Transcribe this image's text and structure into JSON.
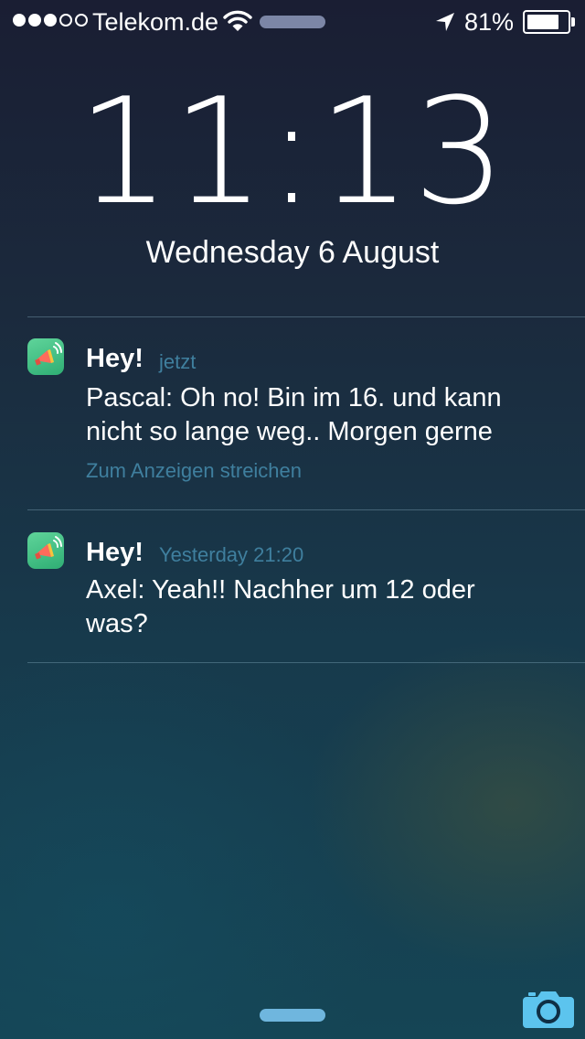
{
  "status_bar": {
    "carrier": "Telekom.de",
    "battery_percent": "81%",
    "battery_level": 0.81,
    "signal_bars_filled": 3,
    "signal_bars_total": 5,
    "icons": [
      "signal-dots",
      "wifi-icon",
      "location-arrow-icon",
      "battery-icon"
    ]
  },
  "lock_screen": {
    "time": "11:13",
    "date": "Wednesday 6 August"
  },
  "notifications": [
    {
      "app_icon": "megaphone-app-icon",
      "title": "Hey!",
      "time": "jetzt",
      "body_lines": [
        "Pascal: Oh no! Bin im 16. und kann",
        "nicht so lange weg.. Morgen gerne"
      ],
      "hint": "Zum Anzeigen streichen"
    },
    {
      "app_icon": "megaphone-app-icon",
      "title": "Hey!",
      "time": "Yesterday 21:20",
      "body_lines": [
        "Axel: Yeah!! Nachher um 12 oder",
        "was?"
      ]
    }
  ],
  "bottom": {
    "icons": [
      "grabber-handle",
      "camera-icon"
    ]
  },
  "colors": {
    "accent_text": "#3f7f9e",
    "app_icon_green": "#3cbf83",
    "grabber": "#6fb6de",
    "camera": "#5cc4ee"
  }
}
